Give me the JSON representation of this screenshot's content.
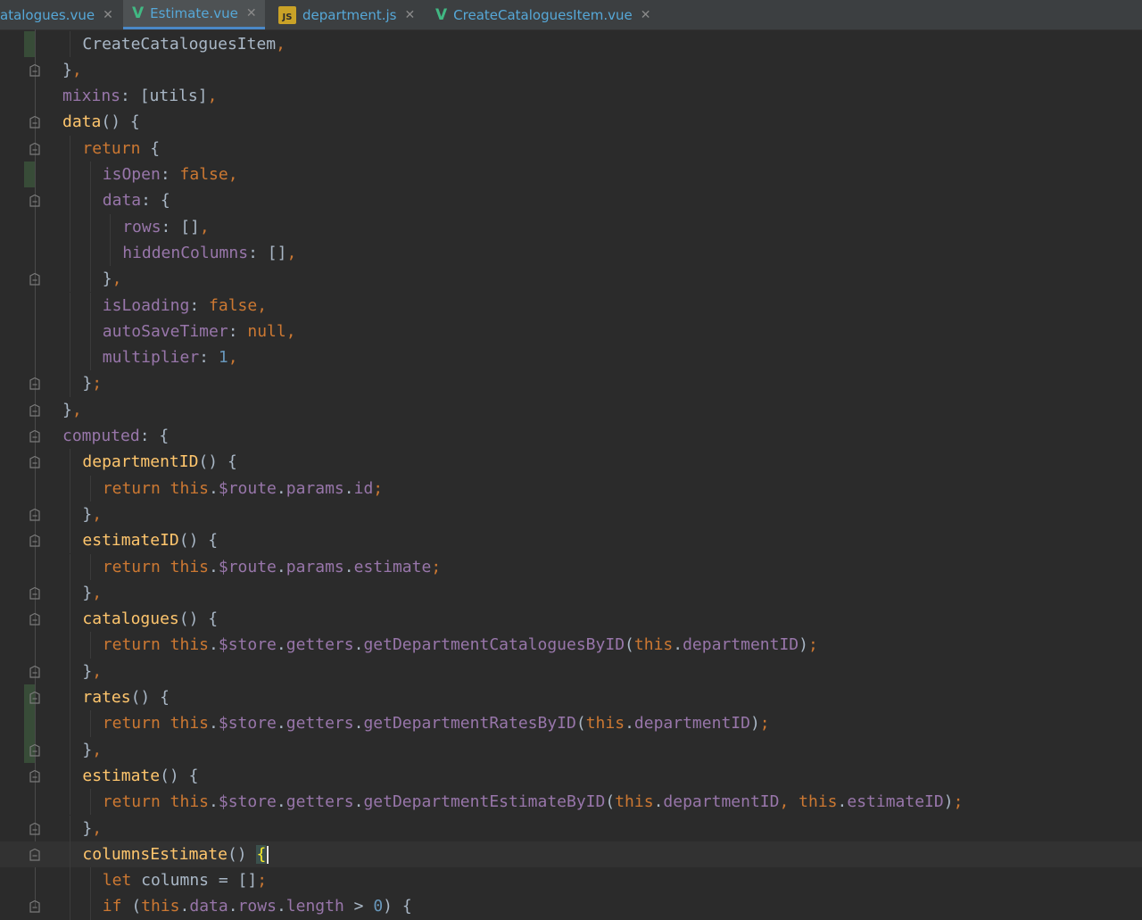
{
  "tabs": [
    {
      "label": "atalogues.vue",
      "kind": "vue",
      "active": false
    },
    {
      "label": "Estimate.vue",
      "kind": "vue",
      "active": true
    },
    {
      "label": "department.js",
      "kind": "js",
      "active": false
    },
    {
      "label": "CreateCataloguesItem.vue",
      "kind": "vue",
      "active": false
    }
  ],
  "colors": {
    "background": "#2b2b2b",
    "keyword": "#cc7832",
    "property": "#9876aa",
    "function": "#ffc66d",
    "number": "#6897bb",
    "text": "#a9b7c6",
    "vue_logo": "#41b883",
    "tab_link": "#56a8d8"
  },
  "icons": {
    "vue": "vue-logo-icon",
    "js": "javascript-file-icon",
    "close": "close-tab-icon",
    "fold": "fold-marker-icon"
  },
  "code_lines": [
    {
      "indent": 2,
      "change": true,
      "fold": false,
      "tokens": [
        {
          "t": "CreateCataloguesItem",
          "c": "t"
        },
        {
          "t": ",",
          "c": "k"
        }
      ]
    },
    {
      "indent": 1,
      "change": false,
      "fold": true,
      "tokens": [
        {
          "t": "}",
          "c": "t"
        },
        {
          "t": ",",
          "c": "k"
        }
      ]
    },
    {
      "indent": 1,
      "change": false,
      "fold": false,
      "tokens": [
        {
          "t": "mixins",
          "c": "p"
        },
        {
          "t": ": [utils]",
          "c": "t"
        },
        {
          "t": ",",
          "c": "k"
        }
      ]
    },
    {
      "indent": 1,
      "change": false,
      "fold": true,
      "tokens": [
        {
          "t": "data",
          "c": "f"
        },
        {
          "t": "() {",
          "c": "t"
        }
      ]
    },
    {
      "indent": 2,
      "change": false,
      "fold": true,
      "tokens": [
        {
          "t": "return",
          "c": "k"
        },
        {
          "t": " {",
          "c": "t"
        }
      ]
    },
    {
      "indent": 3,
      "change": true,
      "fold": false,
      "tokens": [
        {
          "t": "isOpen",
          "c": "p"
        },
        {
          "t": ": ",
          "c": "t"
        },
        {
          "t": "false,",
          "c": "k"
        }
      ]
    },
    {
      "indent": 3,
      "change": false,
      "fold": true,
      "tokens": [
        {
          "t": "data",
          "c": "p"
        },
        {
          "t": ": {",
          "c": "t"
        }
      ]
    },
    {
      "indent": 4,
      "change": false,
      "fold": false,
      "tokens": [
        {
          "t": "rows",
          "c": "p"
        },
        {
          "t": ": []",
          "c": "t"
        },
        {
          "t": ",",
          "c": "k"
        }
      ]
    },
    {
      "indent": 4,
      "change": false,
      "fold": false,
      "tokens": [
        {
          "t": "hiddenColumns",
          "c": "p"
        },
        {
          "t": ": []",
          "c": "t"
        },
        {
          "t": ",",
          "c": "k"
        }
      ]
    },
    {
      "indent": 3,
      "change": false,
      "fold": true,
      "tokens": [
        {
          "t": "}",
          "c": "t"
        },
        {
          "t": ",",
          "c": "k"
        }
      ]
    },
    {
      "indent": 3,
      "change": false,
      "fold": false,
      "tokens": [
        {
          "t": "isLoading",
          "c": "p"
        },
        {
          "t": ": ",
          "c": "t"
        },
        {
          "t": "false,",
          "c": "k"
        }
      ]
    },
    {
      "indent": 3,
      "change": false,
      "fold": false,
      "tokens": [
        {
          "t": "autoSaveTimer",
          "c": "p"
        },
        {
          "t": ": ",
          "c": "t"
        },
        {
          "t": "null,",
          "c": "k"
        }
      ]
    },
    {
      "indent": 3,
      "change": false,
      "fold": false,
      "tokens": [
        {
          "t": "multiplier",
          "c": "p"
        },
        {
          "t": ": ",
          "c": "t"
        },
        {
          "t": "1",
          "c": "n"
        },
        {
          "t": ",",
          "c": "k"
        }
      ]
    },
    {
      "indent": 2,
      "change": false,
      "fold": true,
      "tokens": [
        {
          "t": "}",
          "c": "t"
        },
        {
          "t": ";",
          "c": "k"
        }
      ]
    },
    {
      "indent": 1,
      "change": false,
      "fold": true,
      "tokens": [
        {
          "t": "}",
          "c": "t"
        },
        {
          "t": ",",
          "c": "k"
        }
      ]
    },
    {
      "indent": 1,
      "change": false,
      "fold": true,
      "tokens": [
        {
          "t": "computed",
          "c": "p"
        },
        {
          "t": ": {",
          "c": "t"
        }
      ]
    },
    {
      "indent": 2,
      "change": false,
      "fold": true,
      "tokens": [
        {
          "t": "departmentID",
          "c": "f"
        },
        {
          "t": "() {",
          "c": "t"
        }
      ]
    },
    {
      "indent": 3,
      "change": false,
      "fold": false,
      "tokens": [
        {
          "t": "return this",
          "c": "k"
        },
        {
          "t": ".",
          "c": "t"
        },
        {
          "t": "$route",
          "c": "p"
        },
        {
          "t": ".",
          "c": "t"
        },
        {
          "t": "params",
          "c": "p"
        },
        {
          "t": ".",
          "c": "t"
        },
        {
          "t": "id",
          "c": "p"
        },
        {
          "t": ";",
          "c": "k"
        }
      ]
    },
    {
      "indent": 2,
      "change": false,
      "fold": true,
      "tokens": [
        {
          "t": "}",
          "c": "t"
        },
        {
          "t": ",",
          "c": "k"
        }
      ]
    },
    {
      "indent": 2,
      "change": false,
      "fold": true,
      "tokens": [
        {
          "t": "estimateID",
          "c": "f"
        },
        {
          "t": "() {",
          "c": "t"
        }
      ]
    },
    {
      "indent": 3,
      "change": false,
      "fold": false,
      "tokens": [
        {
          "t": "return this",
          "c": "k"
        },
        {
          "t": ".",
          "c": "t"
        },
        {
          "t": "$route",
          "c": "p"
        },
        {
          "t": ".",
          "c": "t"
        },
        {
          "t": "params",
          "c": "p"
        },
        {
          "t": ".",
          "c": "t"
        },
        {
          "t": "estimate",
          "c": "p"
        },
        {
          "t": ";",
          "c": "k"
        }
      ]
    },
    {
      "indent": 2,
      "change": false,
      "fold": true,
      "tokens": [
        {
          "t": "}",
          "c": "t"
        },
        {
          "t": ",",
          "c": "k"
        }
      ]
    },
    {
      "indent": 2,
      "change": false,
      "fold": true,
      "tokens": [
        {
          "t": "catalogues",
          "c": "f"
        },
        {
          "t": "() {",
          "c": "t"
        }
      ]
    },
    {
      "indent": 3,
      "change": false,
      "fold": false,
      "tokens": [
        {
          "t": "return this",
          "c": "k"
        },
        {
          "t": ".",
          "c": "t"
        },
        {
          "t": "$store",
          "c": "p"
        },
        {
          "t": ".",
          "c": "t"
        },
        {
          "t": "getters",
          "c": "p"
        },
        {
          "t": ".",
          "c": "t"
        },
        {
          "t": "getDepartmentCataloguesByID",
          "c": "p"
        },
        {
          "t": "(",
          "c": "t"
        },
        {
          "t": "this",
          "c": "k"
        },
        {
          "t": ".",
          "c": "t"
        },
        {
          "t": "departmentID",
          "c": "p"
        },
        {
          "t": ")",
          "c": "t"
        },
        {
          "t": ";",
          "c": "k"
        }
      ]
    },
    {
      "indent": 2,
      "change": false,
      "fold": true,
      "tokens": [
        {
          "t": "}",
          "c": "t"
        },
        {
          "t": ",",
          "c": "k"
        }
      ]
    },
    {
      "indent": 2,
      "change": true,
      "fold": true,
      "tokens": [
        {
          "t": "rates",
          "c": "f"
        },
        {
          "t": "() {",
          "c": "t"
        }
      ]
    },
    {
      "indent": 3,
      "change": true,
      "fold": false,
      "tokens": [
        {
          "t": "return this",
          "c": "k"
        },
        {
          "t": ".",
          "c": "t"
        },
        {
          "t": "$store",
          "c": "p"
        },
        {
          "t": ".",
          "c": "t"
        },
        {
          "t": "getters",
          "c": "p"
        },
        {
          "t": ".",
          "c": "t"
        },
        {
          "t": "getDepartmentRatesByID",
          "c": "p"
        },
        {
          "t": "(",
          "c": "t"
        },
        {
          "t": "this",
          "c": "k"
        },
        {
          "t": ".",
          "c": "t"
        },
        {
          "t": "departmentID",
          "c": "p"
        },
        {
          "t": ")",
          "c": "t"
        },
        {
          "t": ";",
          "c": "k"
        }
      ]
    },
    {
      "indent": 2,
      "change": true,
      "fold": true,
      "tokens": [
        {
          "t": "}",
          "c": "t"
        },
        {
          "t": ",",
          "c": "k"
        }
      ]
    },
    {
      "indent": 2,
      "change": false,
      "fold": true,
      "tokens": [
        {
          "t": "estimate",
          "c": "f"
        },
        {
          "t": "() {",
          "c": "t"
        }
      ]
    },
    {
      "indent": 3,
      "change": false,
      "fold": false,
      "tokens": [
        {
          "t": "return this",
          "c": "k"
        },
        {
          "t": ".",
          "c": "t"
        },
        {
          "t": "$store",
          "c": "p"
        },
        {
          "t": ".",
          "c": "t"
        },
        {
          "t": "getters",
          "c": "p"
        },
        {
          "t": ".",
          "c": "t"
        },
        {
          "t": "getDepartmentEstimateByID",
          "c": "p"
        },
        {
          "t": "(",
          "c": "t"
        },
        {
          "t": "this",
          "c": "k"
        },
        {
          "t": ".",
          "c": "t"
        },
        {
          "t": "departmentID",
          "c": "p"
        },
        {
          "t": ", ",
          "c": "k"
        },
        {
          "t": "this",
          "c": "k"
        },
        {
          "t": ".",
          "c": "t"
        },
        {
          "t": "estimateID",
          "c": "p"
        },
        {
          "t": ")",
          "c": "t"
        },
        {
          "t": ";",
          "c": "k"
        }
      ]
    },
    {
      "indent": 2,
      "change": false,
      "fold": true,
      "tokens": [
        {
          "t": "}",
          "c": "t"
        },
        {
          "t": ",",
          "c": "k"
        }
      ]
    },
    {
      "indent": 2,
      "change": false,
      "fold": true,
      "caret": true,
      "tokens": [
        {
          "t": "columnsEstimate",
          "c": "f"
        },
        {
          "t": "() ",
          "c": "t"
        },
        {
          "t": "{",
          "c": "brace-hl"
        }
      ]
    },
    {
      "indent": 3,
      "change": false,
      "fold": false,
      "tokens": [
        {
          "t": "let",
          "c": "k"
        },
        {
          "t": " columns = []",
          "c": "t"
        },
        {
          "t": ";",
          "c": "k"
        }
      ]
    },
    {
      "indent": 3,
      "change": false,
      "fold": true,
      "tokens": [
        {
          "t": "if",
          "c": "k"
        },
        {
          "t": " (",
          "c": "t"
        },
        {
          "t": "this",
          "c": "k"
        },
        {
          "t": ".",
          "c": "t"
        },
        {
          "t": "data",
          "c": "p"
        },
        {
          "t": ".",
          "c": "t"
        },
        {
          "t": "rows",
          "c": "p"
        },
        {
          "t": ".",
          "c": "t"
        },
        {
          "t": "length",
          "c": "p"
        },
        {
          "t": " > ",
          "c": "t"
        },
        {
          "t": "0",
          "c": "n"
        },
        {
          "t": ") {",
          "c": "t"
        }
      ]
    }
  ]
}
